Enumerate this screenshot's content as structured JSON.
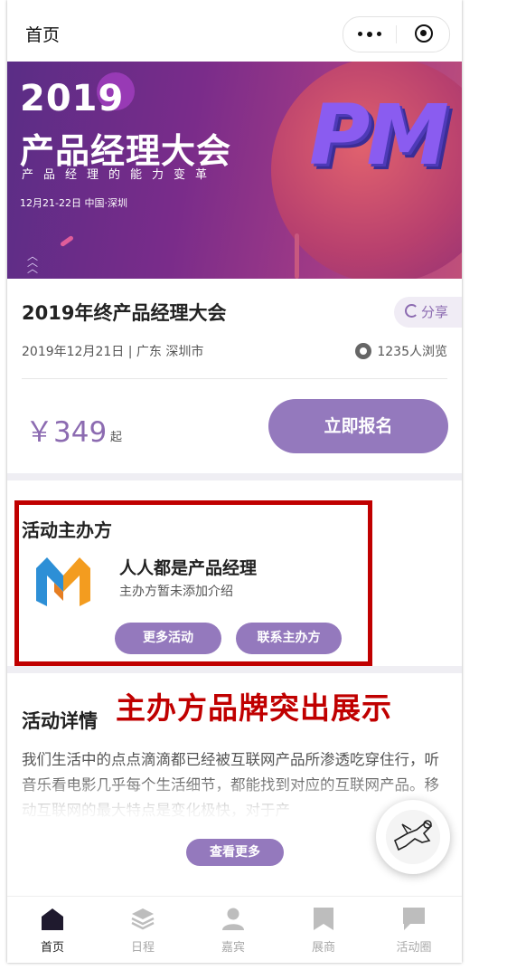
{
  "header": {
    "title": "首页"
  },
  "banner": {
    "year": "2019",
    "name": "产品经理大会",
    "slogan": "产品经理的能力变革",
    "date_place": "12月21-22日 中国·深圳",
    "logo_text": "PM"
  },
  "event": {
    "title": "2019年终产品经理大会",
    "share_label": "分享",
    "date_location": "2019年12月21日 | 广东 深圳市",
    "views": "1235人浏览",
    "price": "￥349",
    "price_suffix": "起",
    "signup_label": "立即报名"
  },
  "organizer": {
    "heading": "活动主办方",
    "name": "人人都是产品经理",
    "description": "主办方暂未添加介绍",
    "more_events_label": "更多活动",
    "contact_label": "联系主办方"
  },
  "annotation": "主办方品牌突出展示",
  "details": {
    "heading": "活动详情",
    "text": "我们生活中的点点滴滴都已经被互联网产品所渗透吃穿住行，听音乐看电影几乎每个生活细节，都能找到对应的互联网产品。移动互联网的最大特点是变化极快，对于产",
    "more_label": "查看更多"
  },
  "tabs": [
    {
      "label": "首页",
      "icon": "home-icon",
      "active": true
    },
    {
      "label": "日程",
      "icon": "layers-icon",
      "active": false
    },
    {
      "label": "嘉宾",
      "icon": "person-icon",
      "active": false
    },
    {
      "label": "展商",
      "icon": "bookmark-icon",
      "active": false
    },
    {
      "label": "活动圈",
      "icon": "chat-icon",
      "active": false
    }
  ],
  "colors": {
    "accent": "#9479bd",
    "annotation_red": "#c00000",
    "banner_purple": "#5a2d86"
  }
}
